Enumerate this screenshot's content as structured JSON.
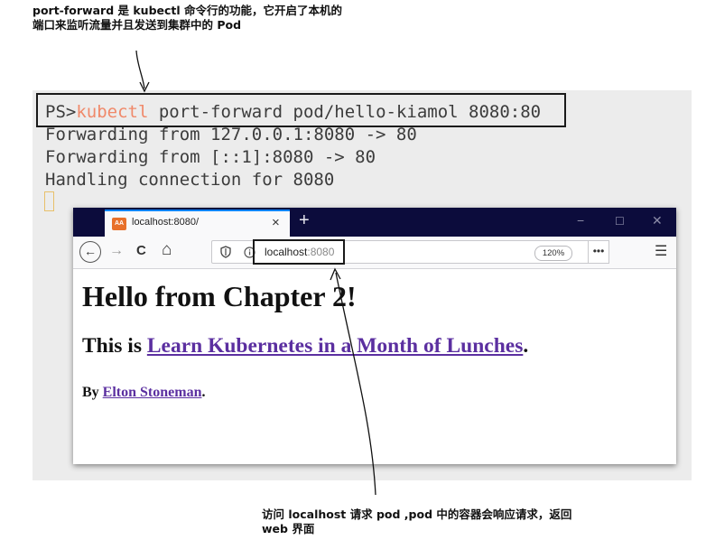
{
  "annotations": {
    "top_line1": "port-forward 是 kubectl 命令行的功能，它开启了本机的",
    "top_line2": "端口来监听流量并且发送到集群中的 Pod",
    "bottom_line1": "访问 localhost 请求 pod ,pod 中的容器会响应请求，返回",
    "bottom_line2": "web 界面"
  },
  "terminal": {
    "prompt": "PS>",
    "command_keyword": "kubectl",
    "command_args": " port-forward pod/hello-kiamol 8080:80",
    "output": [
      "Forwarding from 127.0.0.1:8080 -> 80",
      "Forwarding from [::1]:8080 -> 80",
      "Handling connection for 8080"
    ]
  },
  "browser": {
    "tab_title": "localhost:8080/",
    "tab_close": "×",
    "new_tab": "+",
    "window_buttons": [
      "−",
      "☐",
      "✕"
    ],
    "url_host": "localhost",
    "url_port": ":8080",
    "zoom": "120%",
    "more": "•••",
    "menu": "☰",
    "nav": {
      "back": "←",
      "forward": "→",
      "reload": "C",
      "home": "⌂"
    }
  },
  "page": {
    "heading": "Hello from Chapter 2!",
    "subheading_prefix": "This is ",
    "subheading_link": "Learn Kubernetes in a Month of Lunches",
    "subheading_suffix": ".",
    "byline_prefix": "By ",
    "byline_link": "Elton Stoneman",
    "byline_suffix": "."
  },
  "colors": {
    "terminal_bg": "#ececec",
    "keyword": "#f0896a",
    "titlebar": "#0c0c3c",
    "link": "#5b2fa0"
  }
}
